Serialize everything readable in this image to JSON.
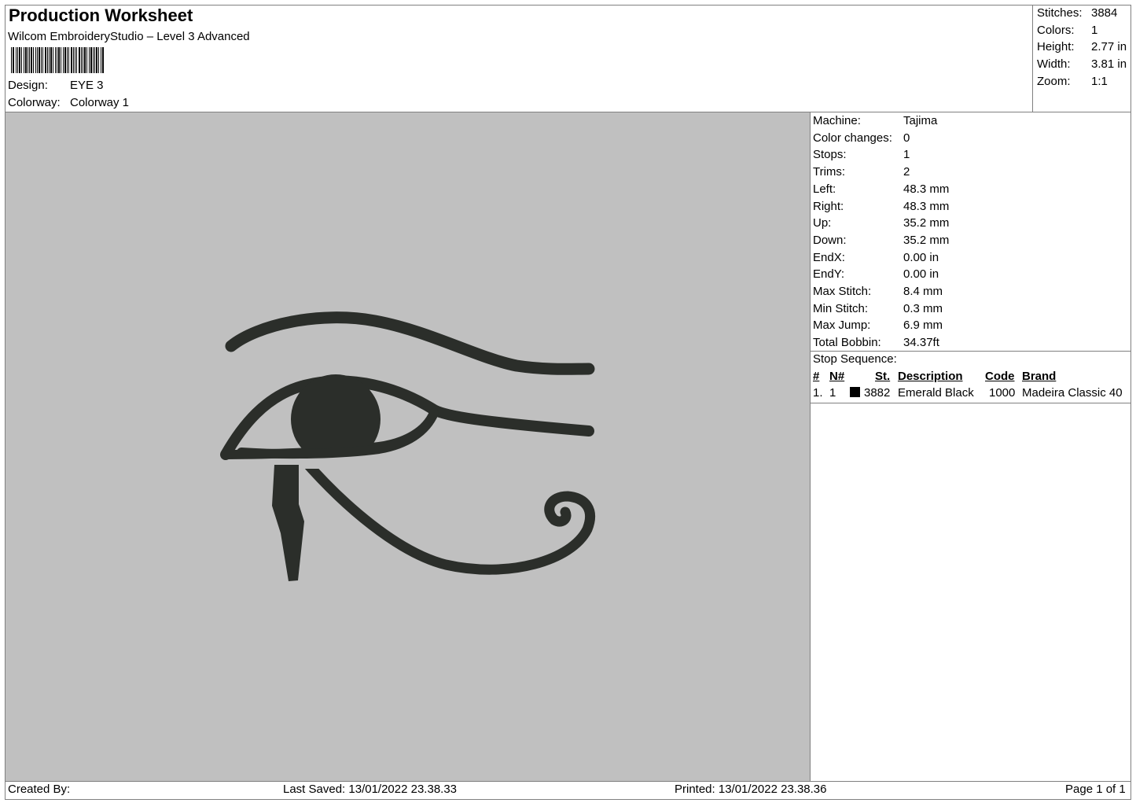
{
  "header": {
    "title": "Production Worksheet",
    "subtitle": "Wilcom EmbroideryStudio – Level 3 Advanced",
    "design_label": "Design:",
    "design_value": "EYE 3",
    "colorway_label": "Colorway:",
    "colorway_value": "Colorway 1"
  },
  "summary": [
    {
      "label": "Stitches:",
      "value": "3884"
    },
    {
      "label": "Colors:",
      "value": "1"
    },
    {
      "label": "Height:",
      "value": "2.77 in"
    },
    {
      "label": "Width:",
      "value": "3.81 in"
    },
    {
      "label": "Zoom:",
      "value": "1:1"
    }
  ],
  "machine_info": [
    {
      "label": "Machine:",
      "value": "Tajima"
    },
    {
      "label": "Color changes:",
      "value": "0"
    },
    {
      "label": "Stops:",
      "value": "1"
    },
    {
      "label": "Trims:",
      "value": "2"
    },
    {
      "label": "Left:",
      "value": "48.3 mm"
    },
    {
      "label": "Right:",
      "value": "48.3 mm"
    },
    {
      "label": "Up:",
      "value": "35.2 mm"
    },
    {
      "label": "Down:",
      "value": "35.2 mm"
    },
    {
      "label": "EndX:",
      "value": "0.00 in"
    },
    {
      "label": "EndY:",
      "value": "0.00 in"
    },
    {
      "label": "Max Stitch:",
      "value": "8.4 mm"
    },
    {
      "label": "Min Stitch:",
      "value": "0.3 mm"
    },
    {
      "label": "Max Jump:",
      "value": "6.9 mm"
    },
    {
      "label": "Total Bobbin:",
      "value": "34.37ft"
    }
  ],
  "stop_sequence": {
    "label": "Stop Sequence:",
    "columns": [
      "#",
      "N#",
      "St.",
      "Description",
      "Code",
      "Brand"
    ],
    "rows": [
      {
        "num": "1.",
        "n": "1",
        "swatch_color": "#000000",
        "stitches": "3882",
        "description": "Emerald Black",
        "code": "1000",
        "brand": "Madeira Classic 40"
      }
    ]
  },
  "design_preview": {
    "background_color": "#c0c0c0",
    "thread_color": "#2b2e2a",
    "motif": "eye-of-horus"
  },
  "footer": {
    "created_by": "Created By:",
    "last_saved": "Last Saved: 13/01/2022 23.38.33",
    "printed": "Printed: 13/01/2022 23.38.36",
    "page": "Page 1 of 1"
  }
}
